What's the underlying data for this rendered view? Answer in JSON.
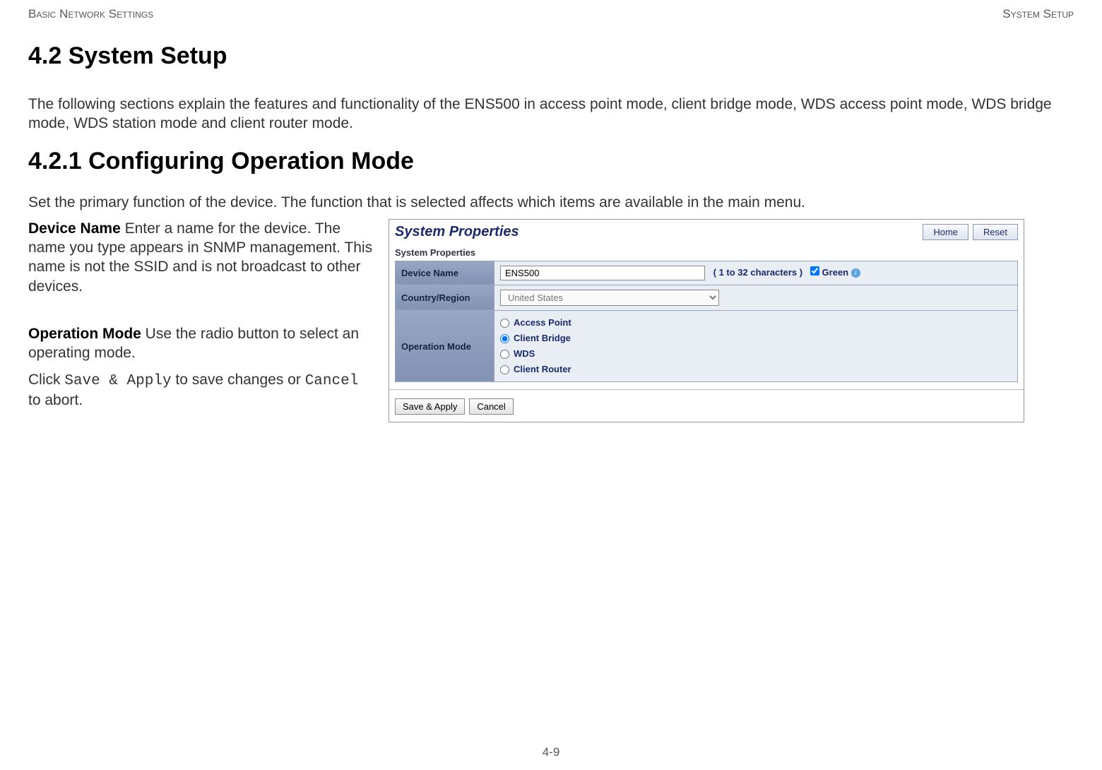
{
  "header": {
    "left": "Basic Network Settings",
    "right": "System Setup"
  },
  "section_heading": "4.2 System Setup",
  "section_intro": "The following sections explain the features and functionality of the ENS500 in access point mode, client bridge mode, WDS access point mode, WDS bridge mode, WDS station mode and client router mode.",
  "subsection_heading": "4.2.1 Configuring Operation Mode",
  "subsection_intro": "Set the primary function of the device. The function that is selected affects which items are available in the main menu.",
  "left_column": {
    "device_name_label": "Device Name",
    "device_name_text": "  Enter a name for the device. The name you type appears in SNMP management. This name is not the SSID and is not broadcast to other devices.",
    "operation_mode_label": "Operation Mode",
    "operation_mode_text": "  Use the radio button to select an operating mode.",
    "save_sentence_pre": "Click ",
    "save_apply_literal": "Save & Apply",
    "save_sentence_mid": " to save changes or ",
    "cancel_literal": "Cancel",
    "save_sentence_post": " to abort."
  },
  "panel": {
    "title": "System Properties",
    "home_btn": "Home",
    "reset_btn": "Reset",
    "subheading": "System Properties",
    "rows": {
      "device_name_label": "Device Name",
      "device_name_value": "ENS500",
      "device_name_hint": "( 1 to 32 characters )",
      "green_label": "Green",
      "country_label": "Country/Region",
      "country_value": "United States",
      "op_mode_label": "Operation Mode",
      "op_options": {
        "access_point": "Access Point",
        "client_bridge": "Client Bridge",
        "wds": "WDS",
        "client_router": "Client Router"
      },
      "op_selected": "client_bridge"
    },
    "footer": {
      "save_apply": "Save & Apply",
      "cancel": "Cancel"
    }
  },
  "page_number": "4-9"
}
